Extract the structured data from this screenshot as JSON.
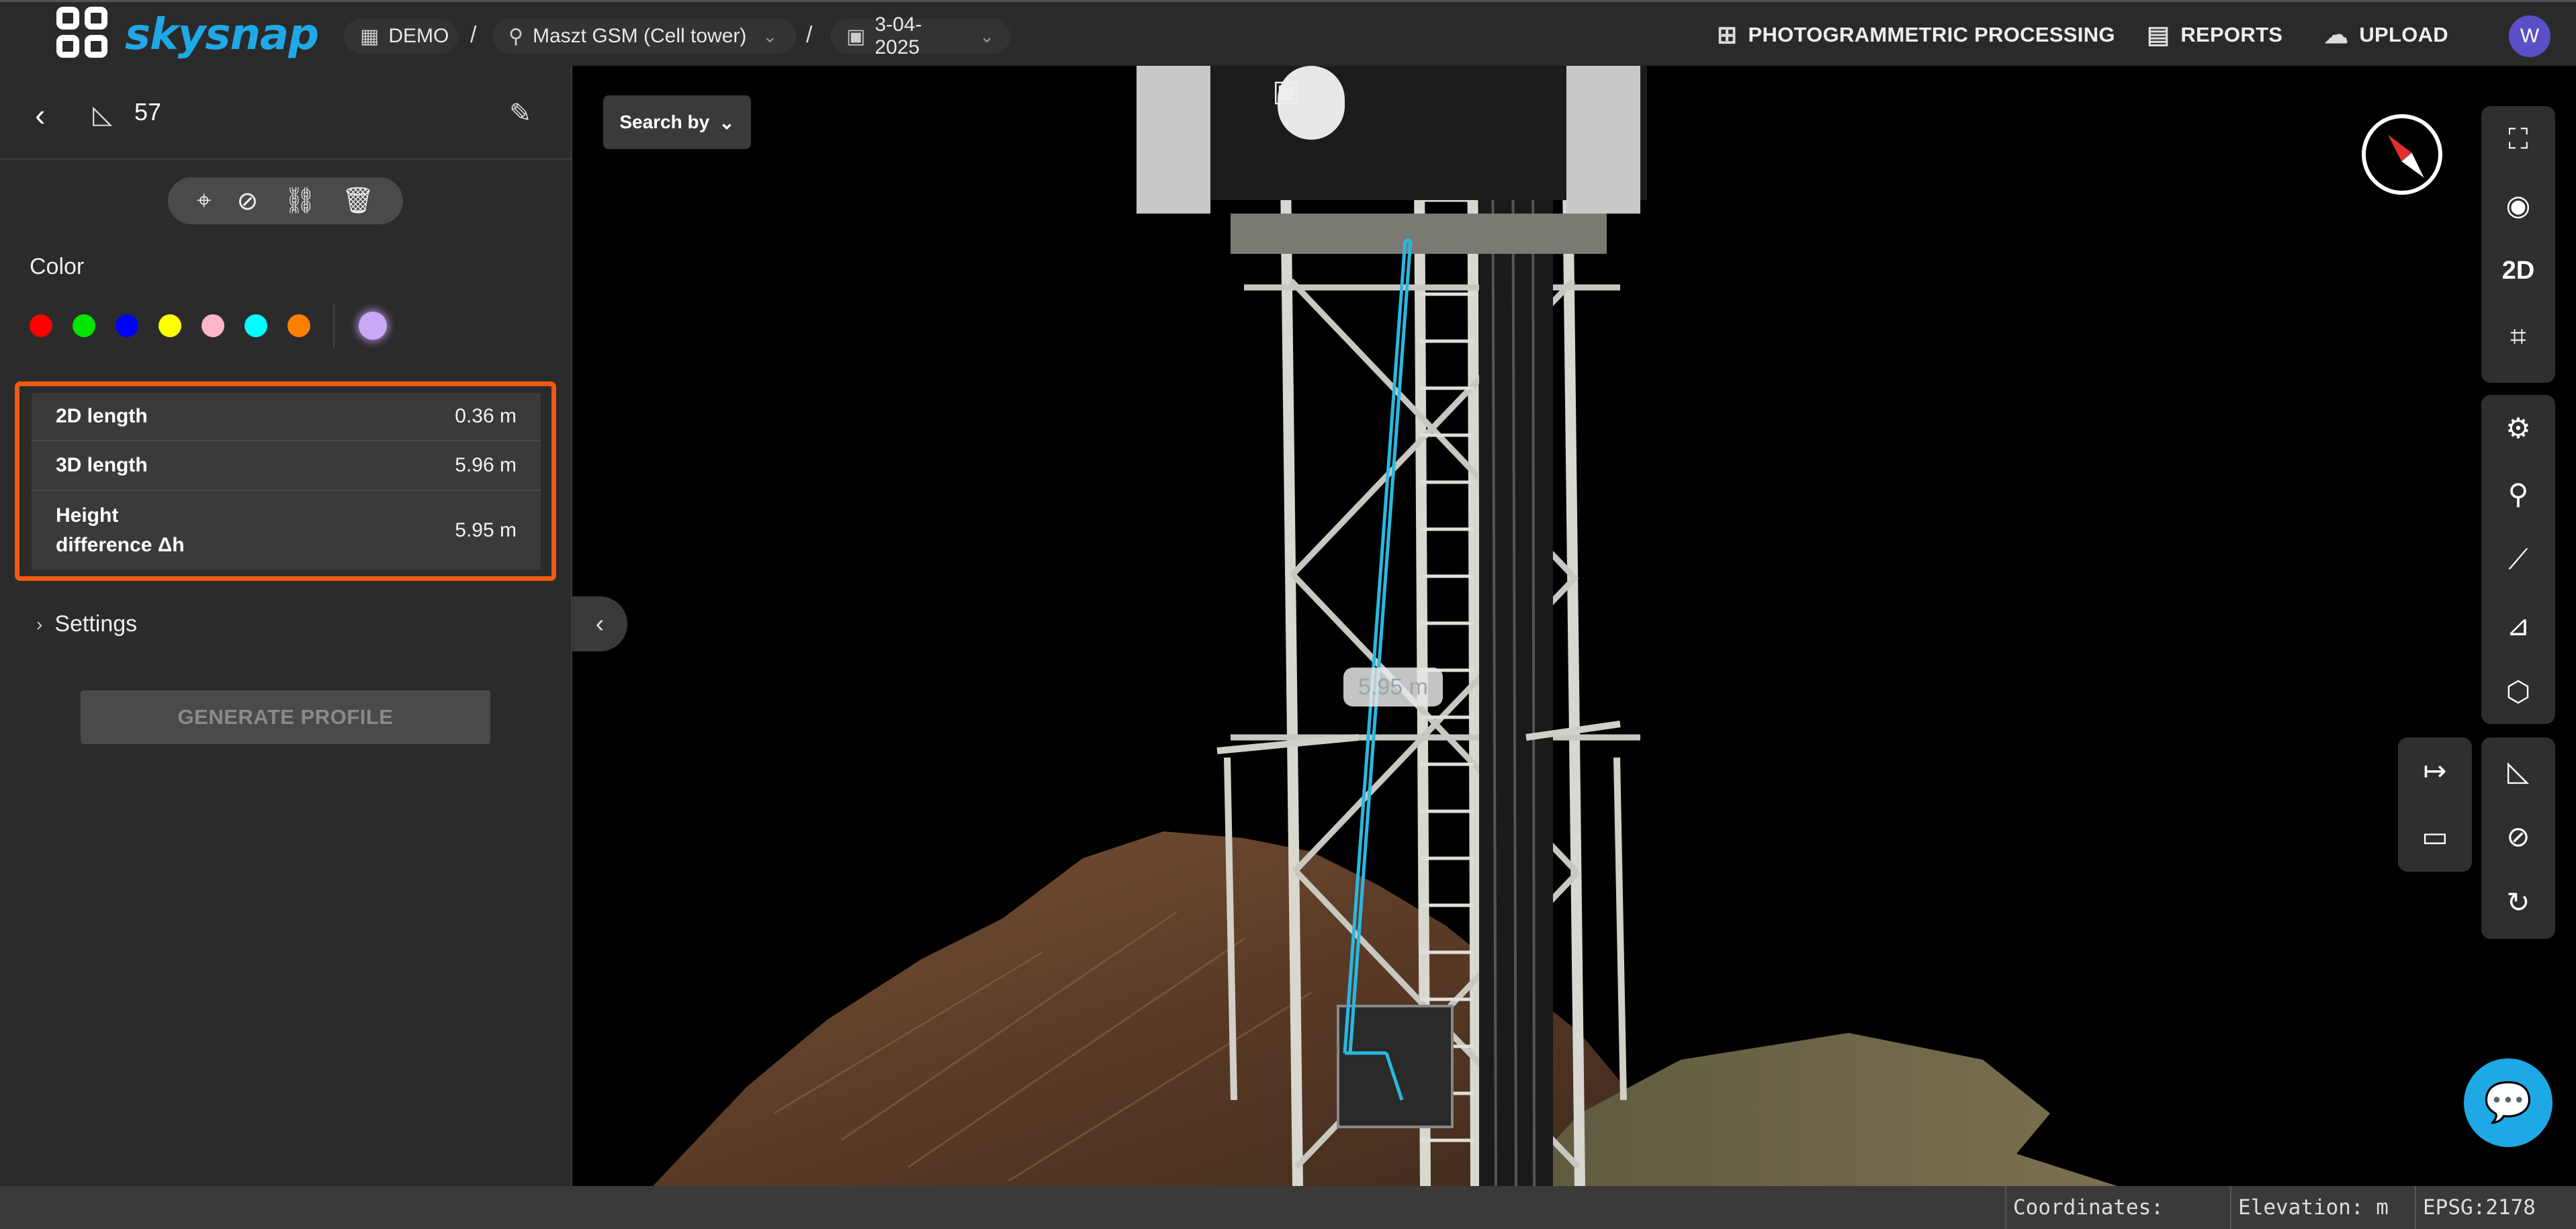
{
  "header": {
    "brand": "skysnap",
    "breadcrumbs": [
      {
        "icon": "building-icon",
        "label": "DEMO"
      },
      {
        "icon": "location-pin-icon",
        "label": "Maszt GSM (Cell tower)"
      },
      {
        "icon": "calendar-icon",
        "label": "3-04-2025"
      }
    ],
    "nav": [
      {
        "icon": "add-photo-icon",
        "label": "PHOTOGRAMMETRIC PROCESSING"
      },
      {
        "icon": "report-icon",
        "label": "REPORTS"
      },
      {
        "icon": "cloud-upload-icon",
        "label": "UPLOAD"
      }
    ],
    "avatar_initial": "W"
  },
  "panel": {
    "measurement_id": "57",
    "color_label": "Color",
    "colors": [
      "#ff0000",
      "#00e600",
      "#0000ff",
      "#ffff00",
      "#ffb6c8",
      "#00ffff",
      "#ff8000"
    ],
    "selected_color": "#c9a9f5",
    "measurements": [
      {
        "label": "2D length",
        "value": "0.36 m"
      },
      {
        "label": "3D length",
        "value": "5.96 m"
      },
      {
        "label": "Height difference Δh",
        "value": "5.95 m"
      }
    ],
    "settings_label": "Settings",
    "generate_button": "GENERATE PROFILE"
  },
  "viewer": {
    "search_by": "Search by",
    "measure_label": "5.95 m",
    "view_mode": "2D"
  },
  "status": {
    "coordinates": "Coordinates:",
    "elevation": "Elevation: m",
    "epsg": "EPSG:2178"
  }
}
